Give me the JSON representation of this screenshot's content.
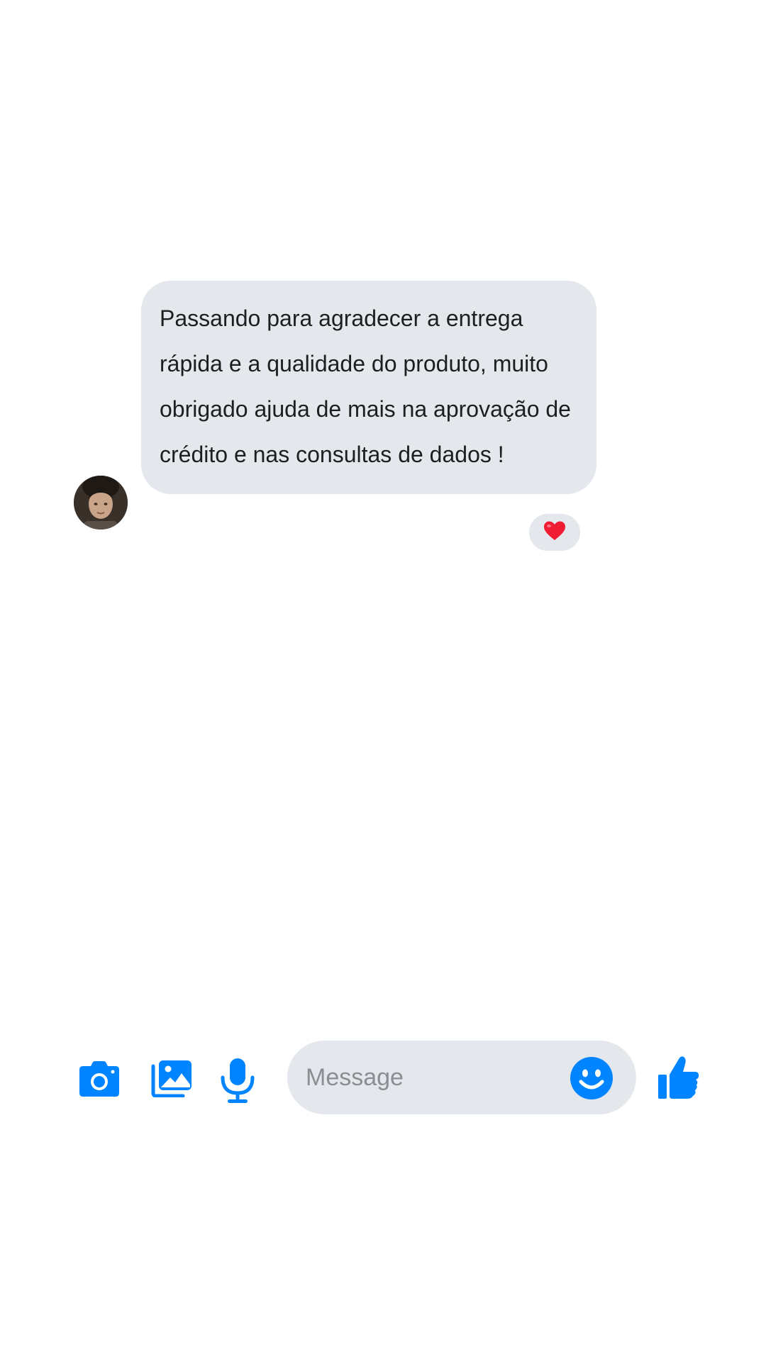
{
  "thread": {
    "message": {
      "text": "Passando para agradecer a entrega rápida e a qualidade do produto, muito obrigado ajuda de mais na aprovação de crédito e nas consultas de dados !",
      "reaction": "❤️"
    }
  },
  "composer": {
    "placeholder": "Message",
    "accent_color": "#0084ff",
    "icons": [
      "camera-icon",
      "gallery-icon",
      "microphone-icon",
      "emoji-icon",
      "thumbs-up-icon"
    ]
  },
  "colors": {
    "bubble_background": "#e4e8ed",
    "text": "#1c1e21",
    "placeholder": "#8a8d91"
  }
}
